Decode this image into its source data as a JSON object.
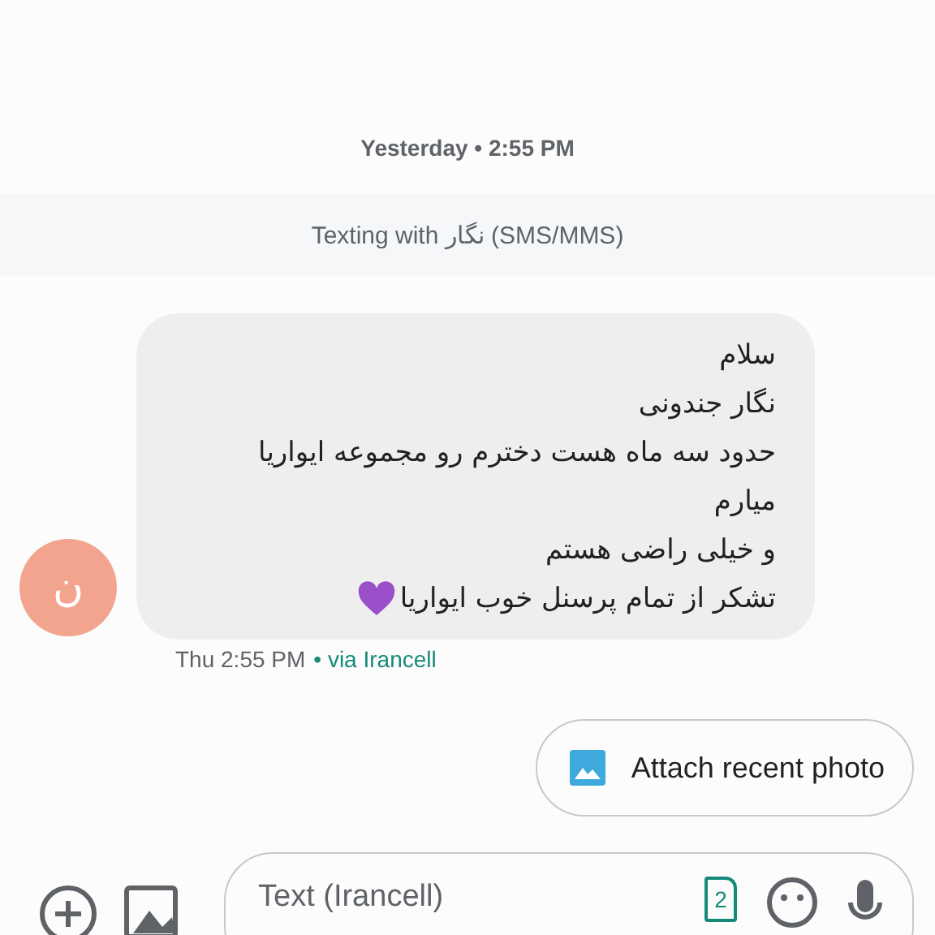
{
  "date_divider": "Yesterday • 2:55 PM",
  "banner": {
    "prefix": "Texting with",
    "contact": "نگار",
    "suffix": "(SMS/MMS)"
  },
  "message": {
    "avatar_letter": "ن",
    "lines": [
      {
        "text": "سلام"
      },
      {
        "text": "نگار جندونی"
      },
      {
        "text": "حدود سه ماه هست دخترم رو مجموعه ایواریا"
      },
      {
        "text": "میارم"
      },
      {
        "text": "و خیلی راضی هستم"
      },
      {
        "text": "تشکر از تمام پرسنل خوب ایواریا",
        "kind": "with_heart"
      }
    ],
    "time": "Thu 2:55 PM",
    "carrier": "• via Irancell"
  },
  "suggestion": {
    "label": "Attach recent photo"
  },
  "composer": {
    "placeholder": "Text (Irancell)",
    "sim": "2"
  }
}
